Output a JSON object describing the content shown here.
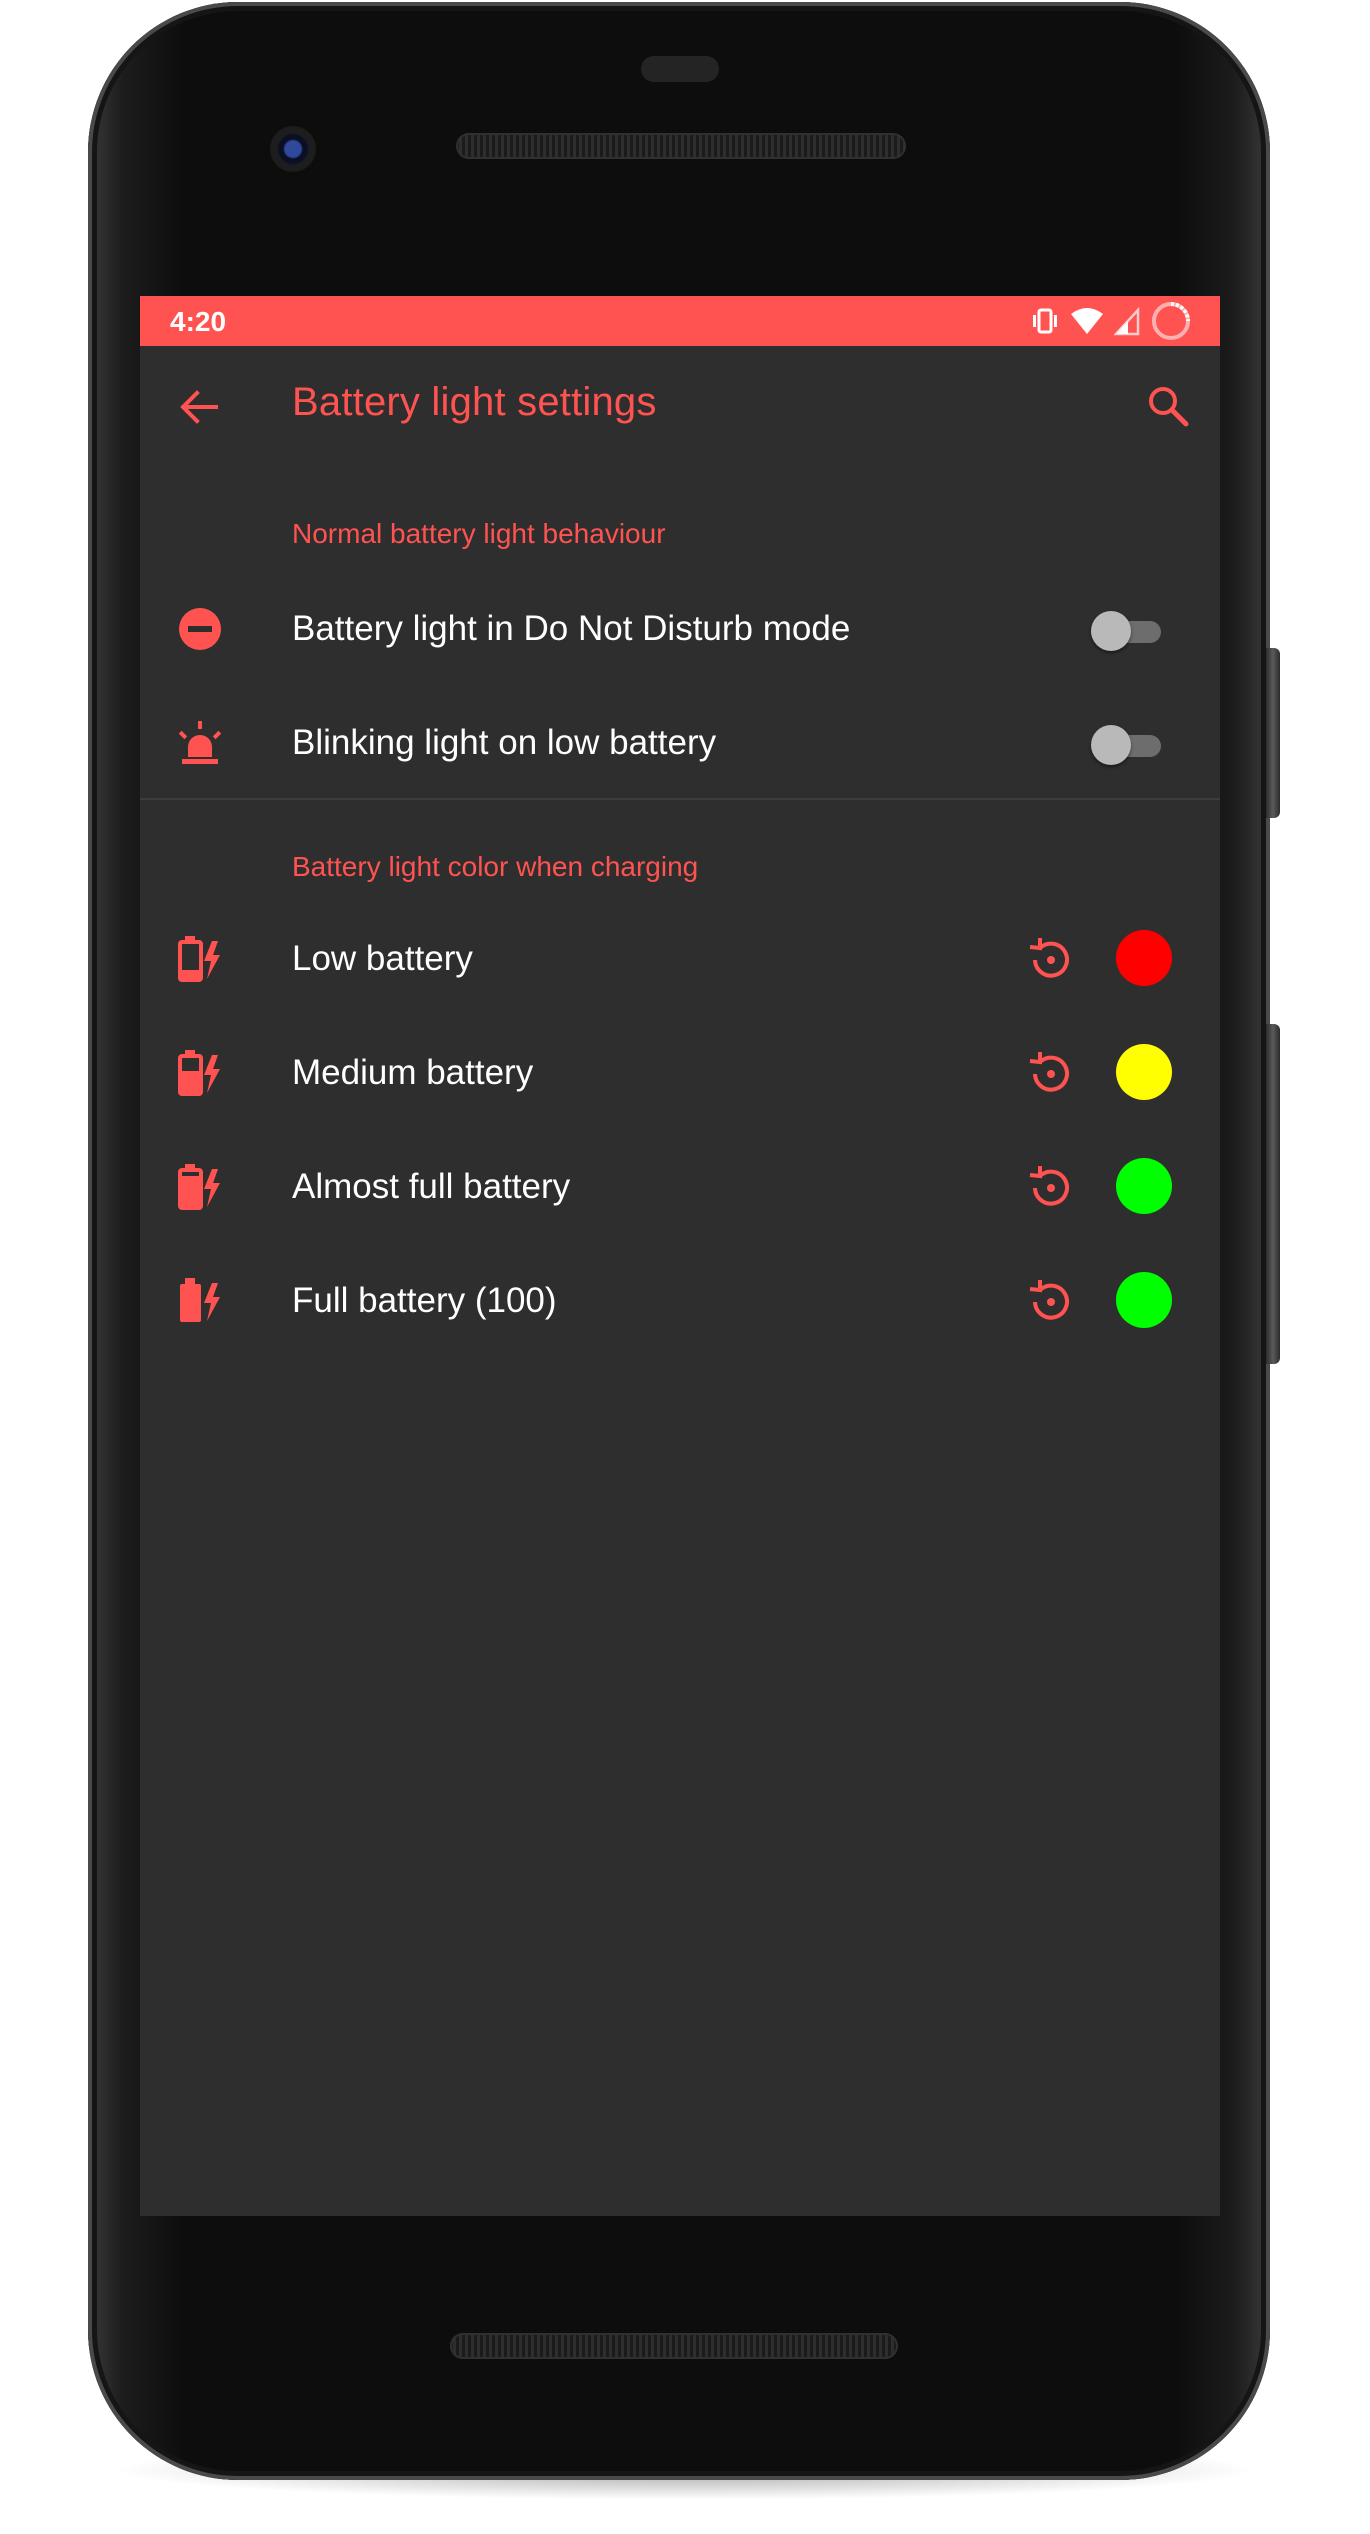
{
  "status_bar": {
    "time": "4:20",
    "background": "#ff5352",
    "icons": [
      "vibrate-icon",
      "wifi-icon",
      "signal-icon",
      "battery-charging-ring-icon"
    ]
  },
  "app_bar": {
    "title": "Battery light settings",
    "back_icon": "arrow-back-icon",
    "search_icon": "search-icon"
  },
  "theme": {
    "accent": "#ff5352",
    "background": "#2e2e2e",
    "text": "#ffffff"
  },
  "sections": [
    {
      "header": "Normal battery light behaviour",
      "items": [
        {
          "label": "Battery light in Do Not Disturb mode",
          "icon": "do-not-disturb-icon",
          "enabled": false
        },
        {
          "label": "Blinking light on low battery",
          "icon": "alarm-light-icon",
          "enabled": false
        }
      ]
    },
    {
      "header": "Battery light color when charging",
      "items": [
        {
          "label": "Low battery",
          "icon": "battery-charging-low-icon",
          "level": 0.2,
          "color": "#ff0000"
        },
        {
          "label": "Medium battery",
          "icon": "battery-charging-medium-icon",
          "level": 0.5,
          "color": "#ffff00"
        },
        {
          "label": "Almost full battery",
          "icon": "battery-charging-almost-full-icon",
          "level": 0.8,
          "color": "#00ff00"
        },
        {
          "label": "Full battery (100)",
          "icon": "battery-charging-full-icon",
          "level": 1.0,
          "color": "#00ff00"
        }
      ]
    }
  ]
}
